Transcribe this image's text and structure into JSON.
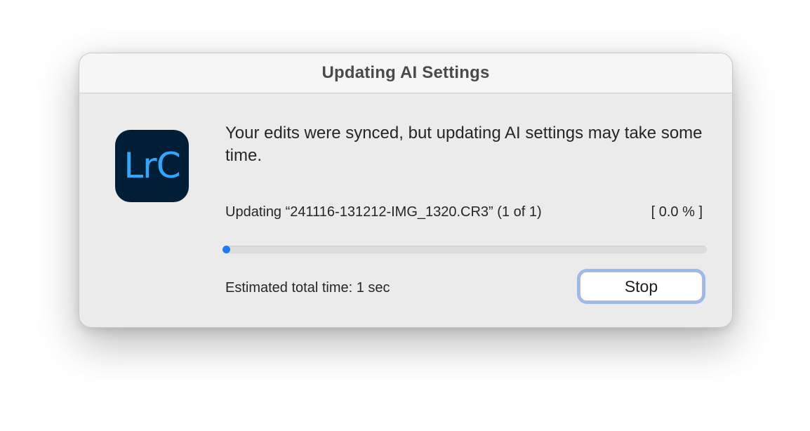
{
  "window": {
    "title": "Updating AI Settings"
  },
  "app_icon": {
    "label": "LrC",
    "background_color": "#001e36",
    "text_color": "#31a8ff"
  },
  "message": "Your edits were synced, but updating AI settings may take some time.",
  "progress": {
    "status_text": "Updating “241116-131212-IMG_1320.CR3” (1 of 1)",
    "percent_text": "[ 0.0 % ]",
    "fraction": 0.0,
    "fill_color": "#1f7bf5"
  },
  "estimate_text": "Estimated total time: 1 sec",
  "buttons": {
    "stop_label": "Stop"
  }
}
